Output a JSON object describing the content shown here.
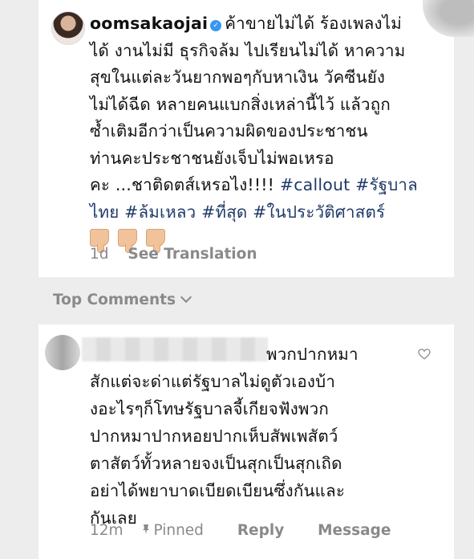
{
  "post": {
    "username": "oomsakaojai",
    "lines": [
      "ค้าขายไม่ได้ ร้องเพลงไม่",
      "ได้ งานไม่มี ธุรกิจล้ม ไปเรียนไม่ได้ หาความ",
      "สุขในแต่ละวันยากพอๆกับหาเงิน วัคซีนยัง",
      "ไม่ได้ฉีด หลายคนแบกสิ่งเหล่านี้ไว้ แล้วถูก",
      "ซ้ำเติมอีกว่าเป็นความผิดของประชาชน",
      "ท่านคะประชาชนยังเจ็บไม่พอเหรอ"
    ],
    "line7_text": "คะ ...ชาติดตส์เหรอไง!!!! ",
    "hashtags_line7": "#callout #รัฐบาล",
    "hashtags_line8": "ไทย #ล้มเหลว #ที่สุด #ในประวัติศาสตร์",
    "emoji_names": [
      "thumbs-down-icon",
      "thumbs-down-icon",
      "thumbs-down-icon"
    ],
    "time": "1d",
    "translate_label": "See Translation"
  },
  "top_comments": {
    "label": "Top Comments"
  },
  "comment": {
    "lines": [
      "พวกปากหมา",
      "สักแต่จะด่าแต่รัฐบาลไม่ดูตัวเองบ้า",
      "งอะไรๆก็โทษรัฐบาลจี้เกียจฟังพวก",
      "ปากหมาปากหอยปากเห็บสัพเพสัตว์",
      "ตาสัตว์ทั้วหลายจงเป็นสุกเป็นสุกเถิด",
      "อย่าได้พยาบาดเบียดเบียนซึ่งกันและ",
      "กันเลย"
    ],
    "time": "12m",
    "pinned_label": "Pinned",
    "reply_label": "Reply",
    "message_label": "Message"
  }
}
